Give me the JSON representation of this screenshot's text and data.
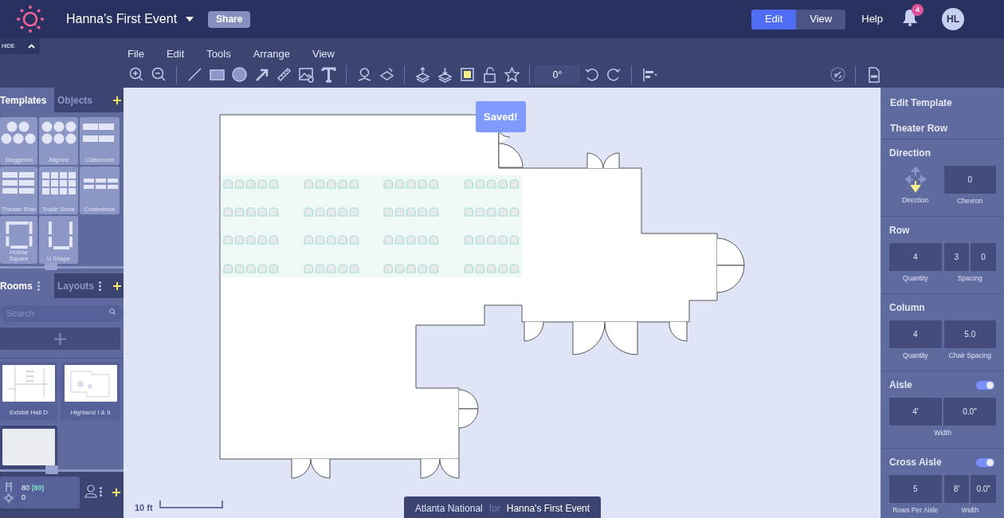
{
  "header": {
    "title": "Hanna's First Event",
    "share": "Share",
    "mode_tabs": [
      {
        "label": "Edit",
        "selected": true
      },
      {
        "label": "View",
        "selected": false
      }
    ],
    "help": "Help",
    "notification_count": "4",
    "avatar": "HL"
  },
  "toolbar": {
    "hide": "HIDE",
    "menu": [
      "File",
      "Edit",
      "Tools",
      "Arrange",
      "View"
    ],
    "rotation": "0°"
  },
  "left_panel": {
    "template_tabs": [
      {
        "label": "Templates",
        "selected": true
      },
      {
        "label": "Objects",
        "selected": false
      }
    ],
    "templates": [
      "Staggered",
      "Aligned",
      "Classroom",
      "Theater Row",
      "Trade Show",
      "Conference",
      "Hollow Square",
      "U Shape"
    ],
    "room_tabs": [
      {
        "label": "Rooms",
        "selected": true
      },
      {
        "label": "Layouts",
        "selected": false
      }
    ],
    "search": {
      "placeholder": "Search"
    },
    "rooms": [
      {
        "label": "Exhibit Hall D",
        "selected": false
      },
      {
        "label": "Highland I & II",
        "selected": false
      },
      {
        "selected": true
      }
    ],
    "stats": {
      "seats": "80",
      "seats_total": "(80)",
      "tables": "0"
    }
  },
  "canvas": {
    "saved": "Saved!",
    "scale": "10 ft",
    "venue": "Atlanta National",
    "connector": "for",
    "event": "Hanna's First Event"
  },
  "right_panel": {
    "title": "Edit Template",
    "template": "Theater Row",
    "sections": [
      {
        "title": "Direction",
        "groups": [
          {
            "kind": "direction",
            "caption": "Direction"
          },
          {
            "kind": "fields",
            "values": [
              "0"
            ],
            "caption": "Chevron"
          }
        ]
      },
      {
        "title": "Row",
        "groups": [
          {
            "kind": "fields",
            "values": [
              "4"
            ],
            "caption": "Quantity"
          },
          {
            "kind": "fields",
            "values": [
              "3",
              "0"
            ],
            "caption": "Spacing"
          }
        ]
      },
      {
        "title": "Column",
        "groups": [
          {
            "kind": "fields",
            "values": [
              "4"
            ],
            "caption": "Quantity"
          },
          {
            "kind": "fields",
            "values": [
              "5.0"
            ],
            "caption": "Chair Spacing"
          }
        ]
      },
      {
        "title": "Aisle",
        "on": true,
        "groups": [
          {
            "kind": "fields",
            "values": [
              "4'",
              "0.0\""
            ],
            "caption": "Width"
          }
        ]
      },
      {
        "title": "Cross Aisle",
        "on": true,
        "groups": [
          {
            "kind": "fields",
            "values": [
              "5"
            ],
            "caption": "Rows Per Aisle"
          },
          {
            "kind": "fields",
            "values": [
              "8'",
              "0.0\""
            ],
            "caption": "Width"
          }
        ]
      }
    ]
  }
}
